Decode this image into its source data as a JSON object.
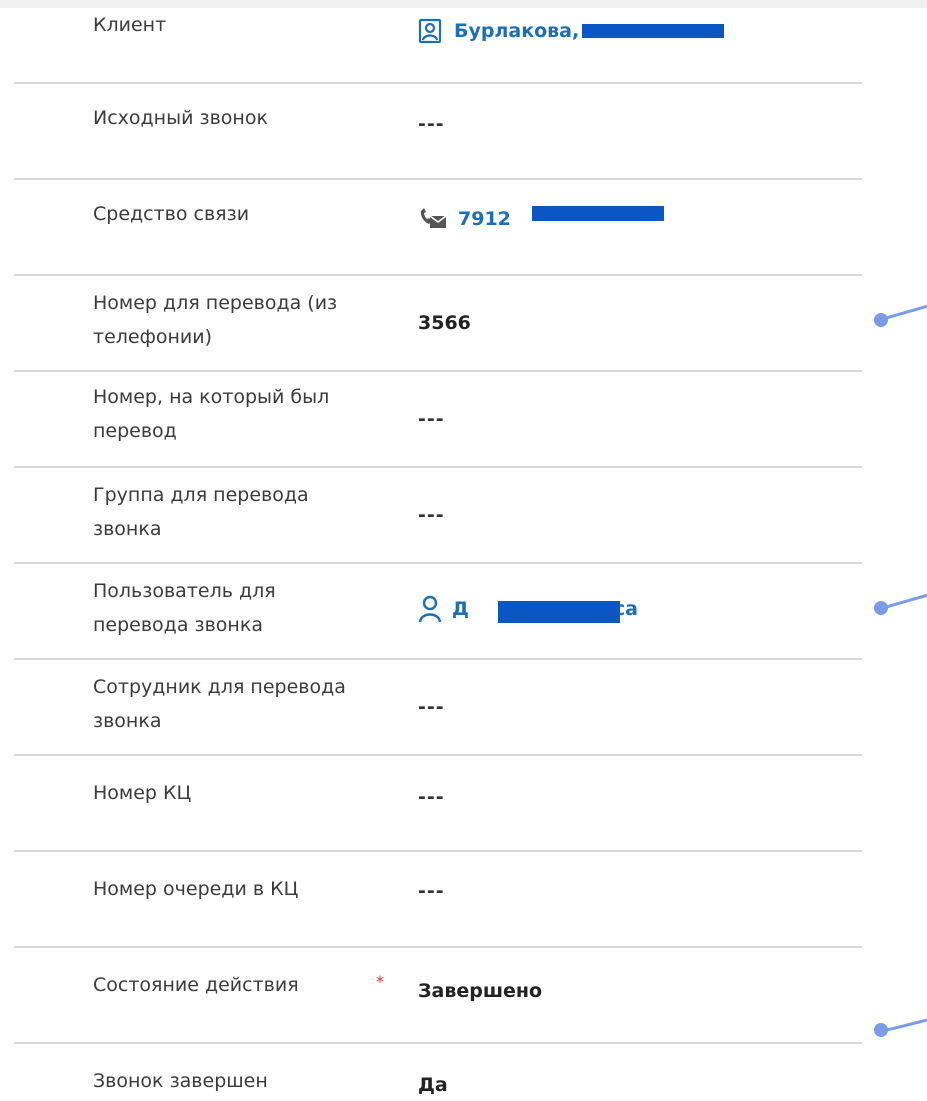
{
  "fields": [
    {
      "label": "Клиент",
      "value": "Бурлакова,",
      "type": "link",
      "icon": "contact-card-icon",
      "required": false
    },
    {
      "label": "Исходный звонок",
      "value": "---",
      "type": "empty",
      "required": false
    },
    {
      "label": "Средство связи",
      "value": "7912",
      "type": "link",
      "icon": "phone-envelope-icon",
      "required": false
    },
    {
      "label": "Номер для перевода (из телефонии)",
      "value": "3566",
      "type": "bold",
      "required": false
    },
    {
      "label": "Номер, на который был перевод",
      "value": "---",
      "type": "empty",
      "required": false
    },
    {
      "label": "Группа для перевода звонка",
      "value": "---",
      "type": "empty",
      "required": false
    },
    {
      "label": "Пользователь для перевода звонка",
      "value": "Д",
      "value_end": "риса",
      "type": "link",
      "icon": "user-icon",
      "required": false
    },
    {
      "label": "Сотрудник для перевода звонка",
      "value": "---",
      "type": "empty",
      "required": false
    },
    {
      "label": "Номер КЦ",
      "value": "---",
      "type": "empty",
      "required": false
    },
    {
      "label": "Номер очереди в КЦ",
      "value": "---",
      "type": "empty",
      "required": false
    },
    {
      "label": "Состояние действия",
      "value": "Завершено",
      "type": "bold",
      "required": true,
      "required_mark": "*"
    },
    {
      "label": "Звонок завершен",
      "value": "Да",
      "type": "bold",
      "required": false
    }
  ],
  "colors": {
    "link": "#1b6fb8",
    "divider": "#d9d9d9",
    "redaction": "#0a57c4",
    "marker": "#7a9be6",
    "required": "#d9302c"
  }
}
